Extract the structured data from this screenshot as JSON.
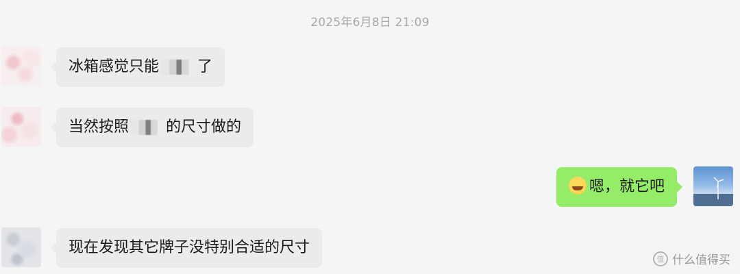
{
  "chat": {
    "timestamp": "2025年6月8日 21:09",
    "messages": [
      {
        "side": "in",
        "text_before": "冰箱感觉只能",
        "text_after": "了"
      },
      {
        "side": "in",
        "text_before": "当然按照",
        "text_after": "的尺寸做的"
      },
      {
        "side": "out",
        "emoji": "laughing-tears-emoji",
        "text": "嗯，就它吧"
      },
      {
        "side": "in",
        "text": "现在发现其它牌子没特别合适的尺寸"
      }
    ]
  },
  "watermark": {
    "text": "什么值得买"
  },
  "colors": {
    "background": "#f5f5f5",
    "incoming_bubble": "#ebebeb",
    "outgoing_bubble": "#95ec69",
    "timestamp": "#a8a8a8"
  }
}
